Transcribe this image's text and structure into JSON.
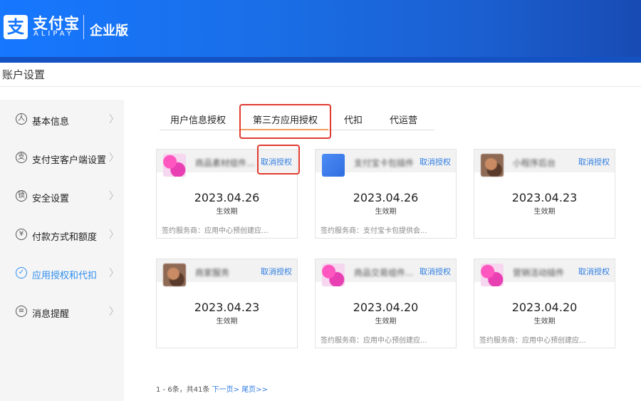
{
  "header": {
    "logo_glyph": "支",
    "logo_cn": "支付宝",
    "logo_en": "ALIPAY",
    "edition": "企业版"
  },
  "page_title": "账户设置",
  "sidebar": {
    "items": [
      {
        "label": "基本信息",
        "icon": "user-icon",
        "glyph": "人"
      },
      {
        "label": "支付宝客户端设置",
        "icon": "alipay-icon",
        "glyph": "支"
      },
      {
        "label": "安全设置",
        "icon": "lock-icon",
        "glyph": "锁"
      },
      {
        "label": "付款方式和额度",
        "icon": "yen-icon",
        "glyph": "¥"
      },
      {
        "label": "应用授权和代扣",
        "icon": "check-icon",
        "glyph": "✓",
        "active": true
      },
      {
        "label": "消息提醒",
        "icon": "message-icon",
        "glyph": "≡"
      }
    ],
    "chevron": "〉"
  },
  "tabs": [
    {
      "label": "用户信息授权"
    },
    {
      "label": "第三方应用授权",
      "active": true
    },
    {
      "label": "代扣"
    },
    {
      "label": "代运营"
    }
  ],
  "cards": [
    {
      "name": "商品素材组件...",
      "revoke": "取消授权",
      "date": "2023.04.26",
      "status": "生效期",
      "provider": "签约服务商：应用中心预创建应..."
    },
    {
      "name": "支付宝卡包插件",
      "revoke": "取消授权",
      "date": "2023.04.26",
      "status": "生效期",
      "provider": "签约服务商：支付宝卡包提供会..."
    },
    {
      "name": "小程序后台",
      "revoke": "取消授权",
      "date": "2023.04.23",
      "status": "生效期",
      "provider": ""
    },
    {
      "name": "商家服务",
      "revoke": "取消授权",
      "date": "2023.04.23",
      "status": "生效期",
      "provider": ""
    },
    {
      "name": "商品交易组件...",
      "revoke": "取消授权",
      "date": "2023.04.20",
      "status": "生效期",
      "provider": "签约服务商：应用中心预创建应..."
    },
    {
      "name": "营销活动插件",
      "revoke": "取消授权",
      "date": "2023.04.20",
      "status": "生效期",
      "provider": "签约服务商：应用中心预创建应..."
    }
  ],
  "pager": {
    "summary": "1 - 6条，共41条",
    "next": "下一页>",
    "last": "尾页>>"
  },
  "colors": {
    "brand": "#1677ff",
    "link": "#2f7de1",
    "active_tab_underline": "#f39b5a",
    "highlight": "#e03a2f"
  }
}
